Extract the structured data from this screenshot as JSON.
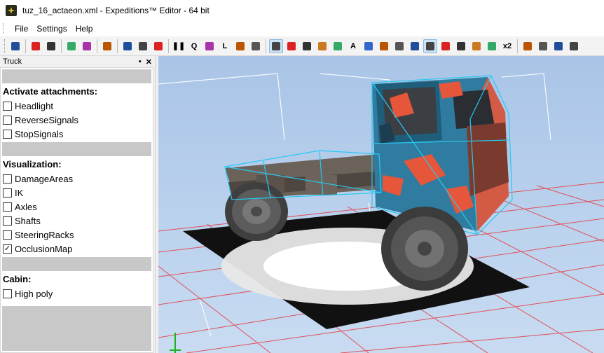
{
  "window": {
    "title": "tuz_16_actaeon.xml - Expeditions™ Editor - 64 bit"
  },
  "menu": [
    "File",
    "Settings",
    "Help"
  ],
  "toolbar": {
    "buttons": [
      {
        "icon": "save-icon"
      },
      {
        "sep": true
      },
      {
        "icon": "object-icon"
      },
      {
        "icon": "axes-icon"
      },
      {
        "sep": true
      },
      {
        "icon": "weather-icon"
      },
      {
        "icon": "cloud-icon"
      },
      {
        "sep": true
      },
      {
        "icon": "list-icon"
      },
      {
        "sep": true
      },
      {
        "icon": "reload-icon"
      },
      {
        "icon": "open-folder-icon"
      },
      {
        "icon": "copy-icon"
      },
      {
        "sep": true
      },
      {
        "icon": "pause-icon",
        "text": "❚❚"
      },
      {
        "icon": "zoom-icon",
        "text": "Q"
      },
      {
        "icon": "rotate-tool-icon"
      },
      {
        "icon": "l-tool-icon",
        "text": "L"
      },
      {
        "icon": "move-tool-icon"
      },
      {
        "icon": "snap-tool-icon"
      },
      {
        "sep": true
      },
      {
        "icon": "text-tool-icon",
        "active": true
      },
      {
        "icon": "face-icon"
      },
      {
        "icon": "record-icon"
      },
      {
        "icon": "path-icon"
      },
      {
        "icon": "audio-icon"
      },
      {
        "icon": "font-icon",
        "text": "A"
      },
      {
        "icon": "pen-icon"
      },
      {
        "icon": "ruler-icon"
      },
      {
        "icon": "star-icon"
      },
      {
        "icon": "flag-icon"
      },
      {
        "icon": "paint-icon",
        "active": true
      },
      {
        "icon": "curve-icon"
      },
      {
        "icon": "dots-icon"
      },
      {
        "icon": "red-square-icon"
      },
      {
        "icon": "grid-icon"
      },
      {
        "icon": "multiply-icon",
        "text": "x2"
      },
      {
        "sep": true
      },
      {
        "icon": "tree-icon"
      },
      {
        "icon": "terrain-icon"
      },
      {
        "icon": "cube-icon"
      },
      {
        "icon": "water-icon"
      }
    ]
  },
  "panel": {
    "title": "Truck",
    "pin": "▪",
    "close": "✕",
    "sections": [
      {
        "label": "Activate attachments:",
        "items": [
          {
            "label": "Headlight",
            "checked": false
          },
          {
            "label": "ReverseSignals",
            "checked": false
          },
          {
            "label": "StopSignals",
            "checked": false
          }
        ]
      },
      {
        "label": "Visualization:",
        "items": [
          {
            "label": "DamageAreas",
            "checked": false
          },
          {
            "label": "IK",
            "checked": false
          },
          {
            "label": "Axles",
            "checked": false
          },
          {
            "label": "Shafts",
            "checked": false
          },
          {
            "label": "SteeringRacks",
            "checked": false
          },
          {
            "label": "OcclusionMap",
            "checked": true
          }
        ]
      },
      {
        "label": "Cabin:",
        "items": [
          {
            "label": "High poly",
            "checked": false
          }
        ]
      }
    ]
  },
  "colors": {
    "camo_blue": "#2f7ca0",
    "camo_orange": "#e5563a",
    "wireframe": "#27c8f0",
    "grid_red": "#e0505a",
    "sky": "#b7cfeb"
  }
}
